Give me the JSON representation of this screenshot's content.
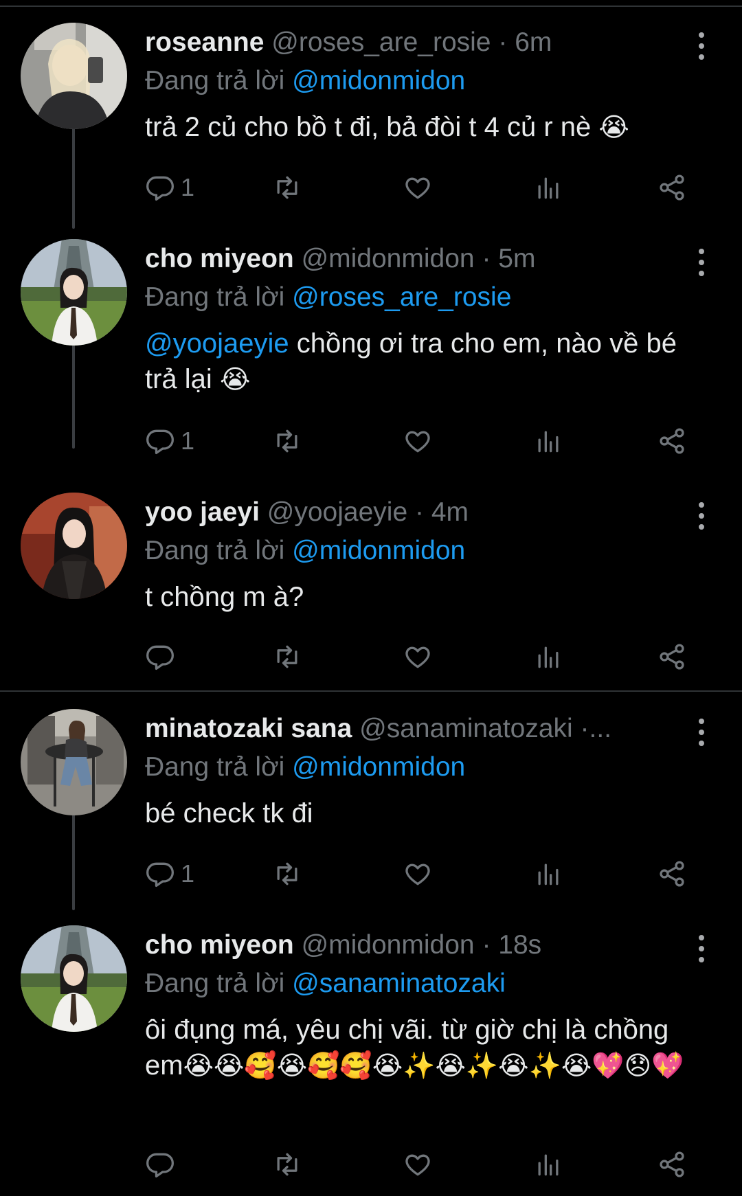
{
  "tweets": [
    {
      "name": "roseanne",
      "handle": "@roses_are_rosie",
      "dot": "·",
      "time": "6m",
      "reply_prefix": "Đang trả lời",
      "reply_to": "@midonmidon",
      "text": "trả 2 củ cho bồ t đi, bả đòi t 4 củ r nè",
      "text_emoji": "😭",
      "reply_count": "1"
    },
    {
      "name": "cho miyeon",
      "handle": "@midonmidon",
      "dot": "·",
      "time": "5m",
      "reply_prefix": "Đang trả lời",
      "reply_to": "@roses_are_rosie",
      "mention": "@yoojaeyie",
      "text": "chồng ơi tra cho em, nào về bé trả lại",
      "text_emoji": "😭",
      "reply_count": "1"
    },
    {
      "name": "yoo jaeyi",
      "handle": "@yoojaeyie",
      "dot": "·",
      "time": "4m",
      "reply_prefix": "Đang trả lời",
      "reply_to": "@midonmidon",
      "text": "t chồng m à?",
      "reply_count": ""
    },
    {
      "name": "minatozaki sana",
      "handle": "@sanaminatozaki",
      "dot": "·...",
      "time": "",
      "reply_prefix": "Đang trả lời",
      "reply_to": "@midonmidon",
      "text": "bé check tk đi",
      "reply_count": "1"
    },
    {
      "name": "cho miyeon",
      "handle": "@midonmidon",
      "dot": "·",
      "time": "18s",
      "reply_prefix": "Đang trả lời",
      "reply_to": "@sanaminatozaki",
      "text": "ôi đụng má, yêu chị vãi. từ giờ chị là chồng em",
      "text_emoji": "😭😭🥰😭🥰🥰😭✨😭✨😭✨😭💖😞💖",
      "reply_count": ""
    }
  ],
  "icons": {
    "reply": "reply-icon",
    "retweet": "retweet-icon",
    "like": "heart-icon",
    "views": "views-icon",
    "share": "share-icon",
    "more": "more-options-icon"
  },
  "colors": {
    "background": "#000000",
    "text": "#e7e9ea",
    "muted": "#71767b",
    "accent": "#1d9bf0",
    "divider": "#2f3336"
  }
}
